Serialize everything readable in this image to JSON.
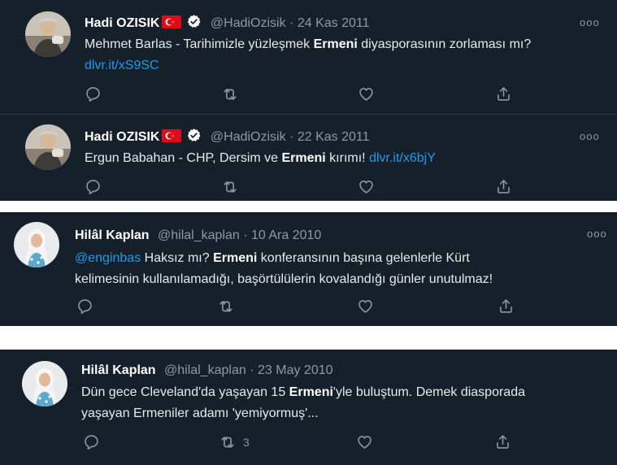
{
  "colors": {
    "background": "#15202b",
    "text": "#e7e9ea",
    "muted": "#8b98a5",
    "link": "#1d9bf0",
    "flag_red": "#e30a17"
  },
  "tweets": [
    {
      "name": "Hadi OZISIK",
      "handle": "@HadiOzisik",
      "sep": "·",
      "date": "24 Kas 2011",
      "text": {
        "t1": "Mehmet Barlas - Tarihimizle yüzleşmek ",
        "bold": "Ermeni",
        "t2": " diyasporasının zorlaması mı?",
        "link": "dlvr.it/xS9SC"
      },
      "icons": [
        "flag-icon",
        "verified-icon"
      ]
    },
    {
      "name": "Hadi OZISIK",
      "handle": "@HadiOzisik",
      "sep": "·",
      "date": "22 Kas 2011",
      "text": {
        "t1": "Ergun Babahan - CHP, Dersim ve ",
        "bold": "Ermeni",
        "t2": " kırımı! ",
        "link": "dlvr.it/x6bjY"
      }
    },
    {
      "name": "Hilâl Kaplan",
      "handle": "@hilal_kaplan",
      "sep": "·",
      "date": "10 Ara 2010",
      "text": {
        "mention": "@enginbas",
        "t1": " Haksız mı? ",
        "bold": "Ermeni",
        "t2": " konferansının başına gelenlerle Kürt",
        "line2": "kelimesinin kullanılamadığı, başörtülülerin kovalandığı günler unutulmaz!"
      }
    },
    {
      "name": "Hilâl Kaplan",
      "handle": "@hilal_kaplan",
      "sep": "·",
      "date": "23 May 2010",
      "text": {
        "t1": "Dün gece Cleveland'da yaşayan 15 ",
        "bold": "Ermeni",
        "t2": "'yle buluştum. Demek  diasporada",
        "line2": "yaşayan Ermeniler adamı 'yemiyormuş'..."
      },
      "retweet_count": "3"
    }
  ],
  "action_icons": [
    "reply-icon",
    "retweet-icon",
    "like-icon",
    "share-icon"
  ],
  "more_label": "ooo"
}
